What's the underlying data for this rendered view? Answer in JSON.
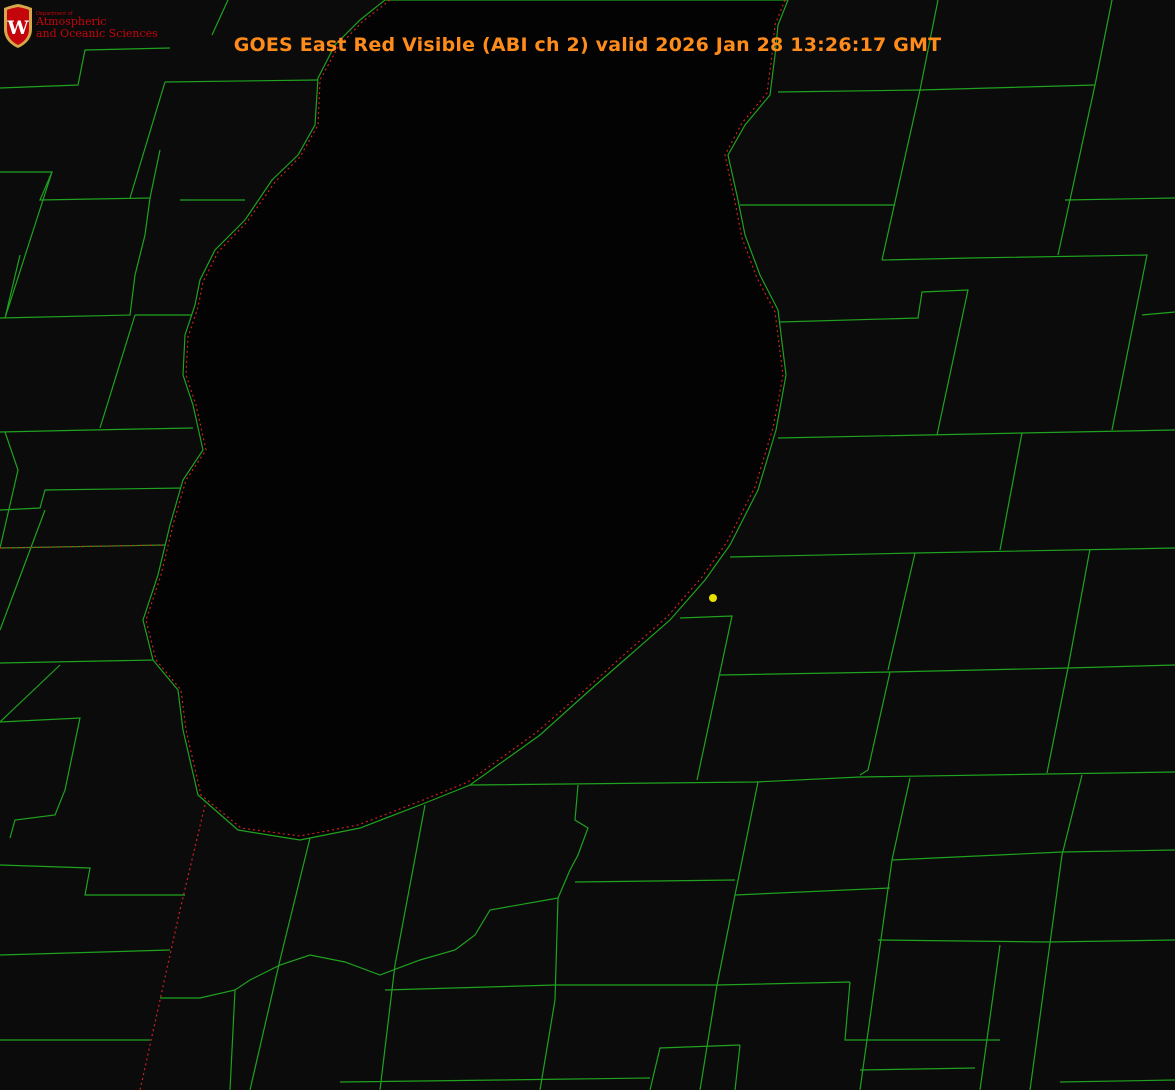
{
  "title": "GOES East Red Visible (ABI ch 2) valid 2026 Jan 28 13:26:17 GMT",
  "logo": {
    "crest_letter": "W",
    "department": "Department of",
    "line1": "Atmospheric",
    "line2": "and Oceanic Sciences"
  },
  "colors": {
    "background": "#000000",
    "land": "#0b0b0b",
    "lake": "#030303",
    "title": "#ff8c1a",
    "county_border": "#1fa21f",
    "state_border": "#d02020",
    "marker": "#e8e000",
    "logo_red": "#c5050c",
    "logo_gold": "#d4a84a"
  },
  "icons": [
    "uw-crest-icon",
    "station-marker-icon"
  ]
}
